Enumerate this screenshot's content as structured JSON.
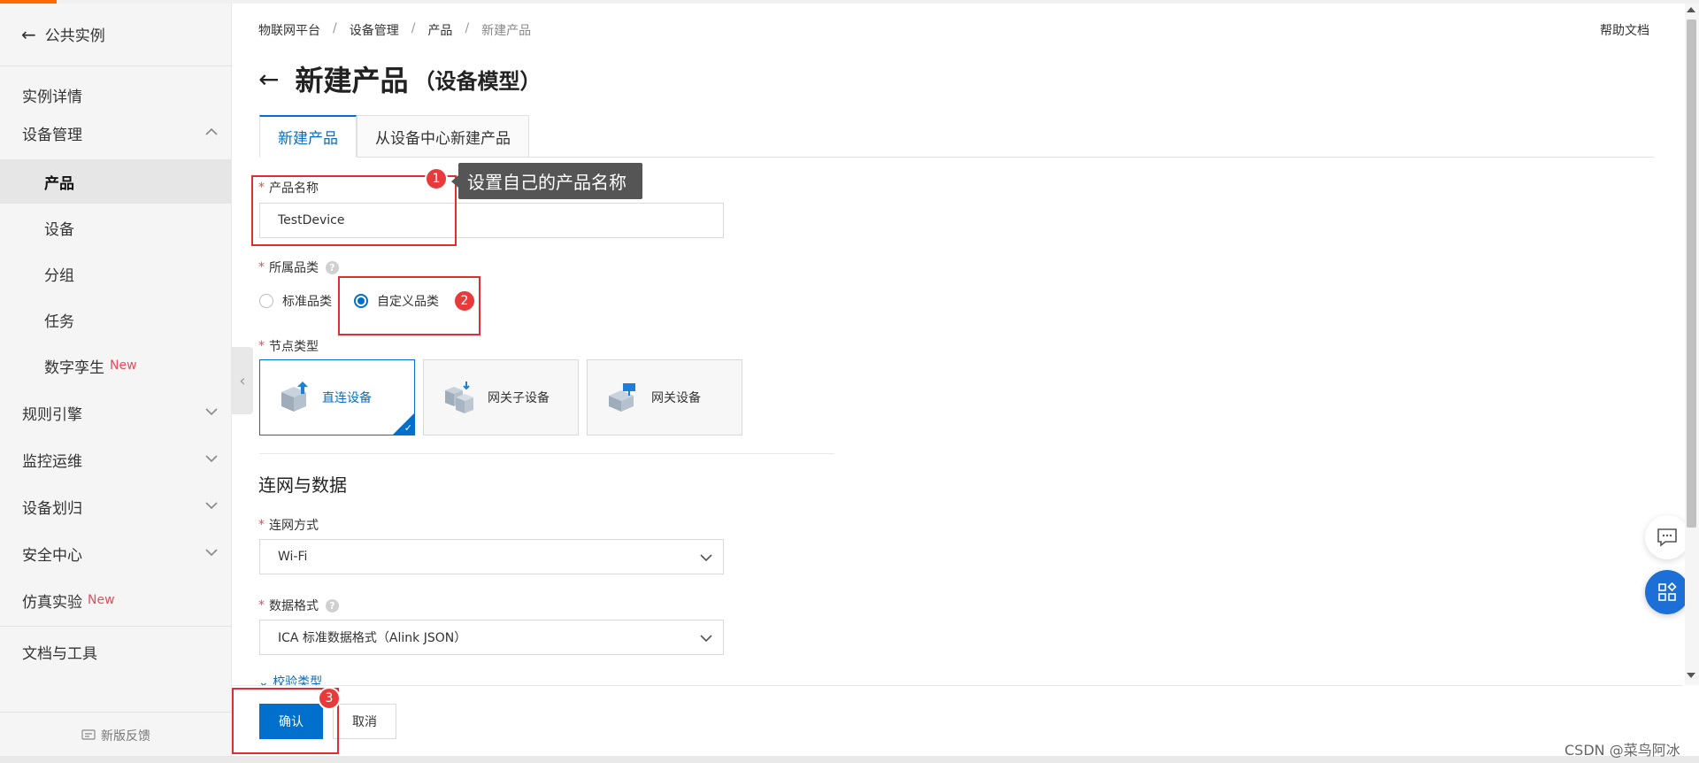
{
  "sidebar": {
    "back_label": "公共实例",
    "items": [
      {
        "label": "实例详情"
      },
      {
        "label": "设备管理"
      },
      {
        "label": "产品"
      },
      {
        "label": "设备"
      },
      {
        "label": "分组"
      },
      {
        "label": "任务"
      },
      {
        "label": "数字孪生",
        "badge": "New"
      },
      {
        "label": "规则引擎"
      },
      {
        "label": "监控运维"
      },
      {
        "label": "设备划归"
      },
      {
        "label": "安全中心"
      },
      {
        "label": "仿真实验",
        "badge": "New"
      },
      {
        "label": "文档与工具"
      }
    ],
    "feedback_label": "新版反馈"
  },
  "breadcrumb": [
    "物联网平台",
    "设备管理",
    "产品",
    "新建产品"
  ],
  "help_label": "帮助文档",
  "page": {
    "title": "新建产品",
    "subtitle": "（设备模型）"
  },
  "tabs": [
    {
      "label": "新建产品",
      "active": true
    },
    {
      "label": "从设备中心新建产品",
      "active": false
    }
  ],
  "form": {
    "product_name": {
      "label": "产品名称",
      "value": "TestDevice"
    },
    "category": {
      "label": "所属品类",
      "options": [
        "标准品类",
        "自定义品类"
      ],
      "selected": "自定义品类"
    },
    "node_type": {
      "label": "节点类型",
      "options": [
        "直连设备",
        "网关子设备",
        "网关设备"
      ],
      "selected": "直连设备"
    },
    "section_title": "连网与数据",
    "network": {
      "label": "连网方式",
      "value": "Wi-Fi"
    },
    "data_format": {
      "label": "数据格式",
      "value": "ICA 标准数据格式（Alink JSON）"
    },
    "collapsed_link": "校验类型"
  },
  "footer": {
    "confirm": "确认",
    "cancel": "取消"
  },
  "annotations": {
    "badges": [
      "1",
      "2",
      "3"
    ],
    "tooltip": "设置自己的产品名称",
    "color": "#e02e2e"
  },
  "watermark": "CSDN @菜鸟阿冰",
  "colors": {
    "primary": "#0070cc",
    "accent": "#ff6a00",
    "required": "#e34d59"
  }
}
